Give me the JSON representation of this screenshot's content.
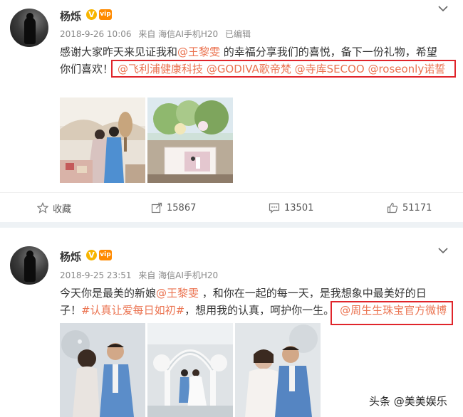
{
  "post1": {
    "username": "杨烁",
    "verified_badge": "V",
    "vip_badge": "vip",
    "meta": {
      "date": "2018-9-26 10:06",
      "source": "来自 海信AI手机H20",
      "status": "已编辑"
    },
    "text": {
      "p1": "感谢大家昨天来见证我和",
      "mention1": "@王黎雯",
      "p2": " 的幸福分享我们的喜悦，备下一份礼物，希望",
      "p3": "你们喜欢！",
      "mention2": "@飞利浦健康科技",
      "mention3": "@GODIVA歌帝梵",
      "mention4": "@寺库SECOO",
      "mention5": "@roseonly诺誓"
    },
    "actions": {
      "favorite": "收藏",
      "repost": "15867",
      "comment": "13501",
      "like": "51171"
    }
  },
  "post2": {
    "username": "杨烁",
    "verified_badge": "V",
    "vip_badge": "vip",
    "meta": {
      "date": "2018-9-25 23:51",
      "source": "来自 海信AI手机H20"
    },
    "text": {
      "p1": "今天你是最美的新娘",
      "mention1": "@王黎雯",
      "p2": " ，和你在一起的每一天，是我想象中最美好的日",
      "p3": "子！",
      "hashtag": "#认真让爱每日如初#",
      "p4": "，想用我的认真，呵护你一生。",
      "mention2": "@周生生珠宝官方微博"
    }
  },
  "watermark": {
    "icon": "toutiao-icon",
    "text": "头条 @美美娱乐"
  },
  "colors": {
    "link": "#eb7350",
    "highlight_box": "#e0252b",
    "separator": "#eef2f5",
    "meta_text": "#888888"
  }
}
